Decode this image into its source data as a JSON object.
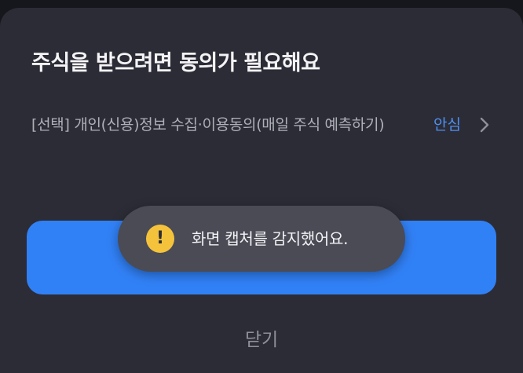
{
  "sheet": {
    "title": "주식을 받으려면 동의가 필요해요",
    "consent": {
      "text": "[선택] 개인(신용)정보 수집·이용동의(매일 주식 예측하기)",
      "view_label": "안심",
      "chevron_icon": "chevron-right-icon"
    },
    "primary_button_label": "",
    "close_label": "닫기"
  },
  "toast": {
    "icon": "warning-icon",
    "icon_glyph": "!",
    "message": "화면 캡처를 감지했어요."
  },
  "colors": {
    "background": "#16171c",
    "sheet": "#2c2c36",
    "accent": "#3181f6",
    "link": "#4e8ff0",
    "toast": "#4a4b55",
    "warning": "#f5c33b"
  }
}
